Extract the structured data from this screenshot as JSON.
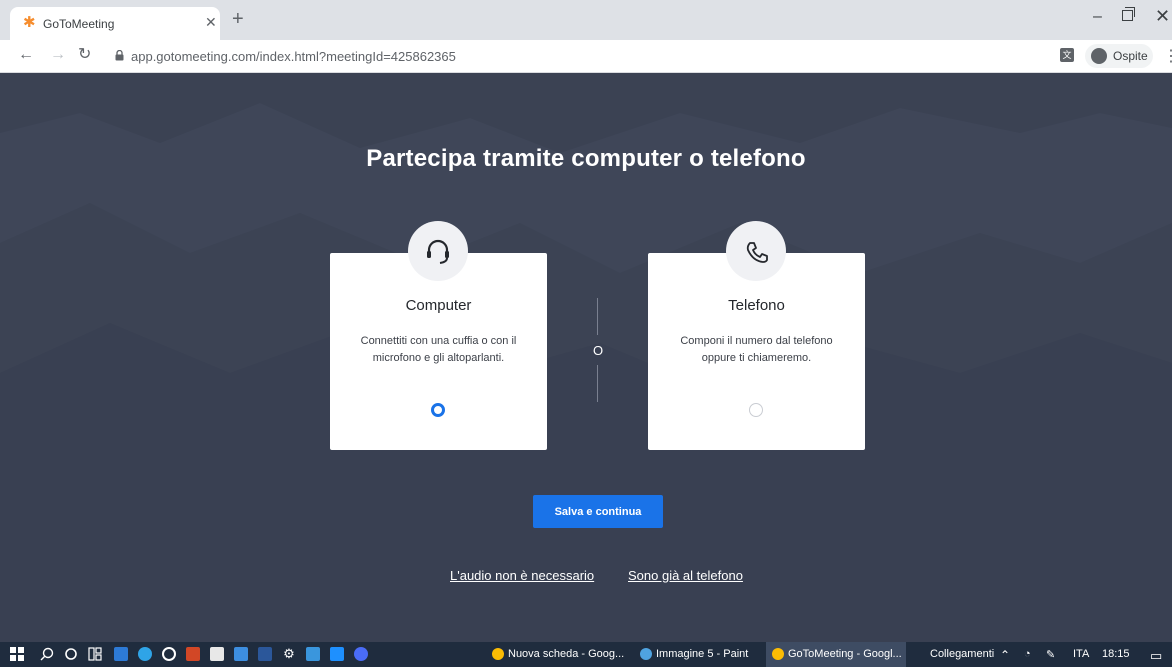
{
  "browser": {
    "tab_title": "GoToMeeting",
    "url": "app.gotomeeting.com/index.html?meetingId=425862365",
    "profile_name": "Ospite"
  },
  "page": {
    "heading": "Partecipa tramite computer o telefono",
    "options": [
      {
        "icon": "headset-icon",
        "title": "Computer",
        "description": "Connettiti con una cuffia o con il microfono e gli altoparlanti.",
        "selected": true
      },
      {
        "icon": "phone-icon",
        "title": "Telefono",
        "description": "Componi il numero dal telefono oppure ti chiameremo.",
        "selected": false
      }
    ],
    "separator": "O",
    "primary_button": "Salva e continua",
    "links": {
      "no_audio": "L'audio non è necessario",
      "already_on_phone": "Sono già al telefono"
    }
  },
  "taskbar": {
    "apps": [
      {
        "icon": "chrome-icon",
        "label": "Nuova scheda - Goog...",
        "active": false
      },
      {
        "icon": "paint-icon",
        "label": "Immagine 5 - Paint",
        "active": false
      },
      {
        "icon": "chrome-icon",
        "label": "GoToMeeting - Googl...",
        "active": true
      }
    ],
    "tray_label": "Collegamenti",
    "language": "ITA",
    "time": "18:15"
  },
  "colors": {
    "page_background": "#3b4253",
    "accent": "#1a73e8",
    "brand": "#f68d2e"
  }
}
